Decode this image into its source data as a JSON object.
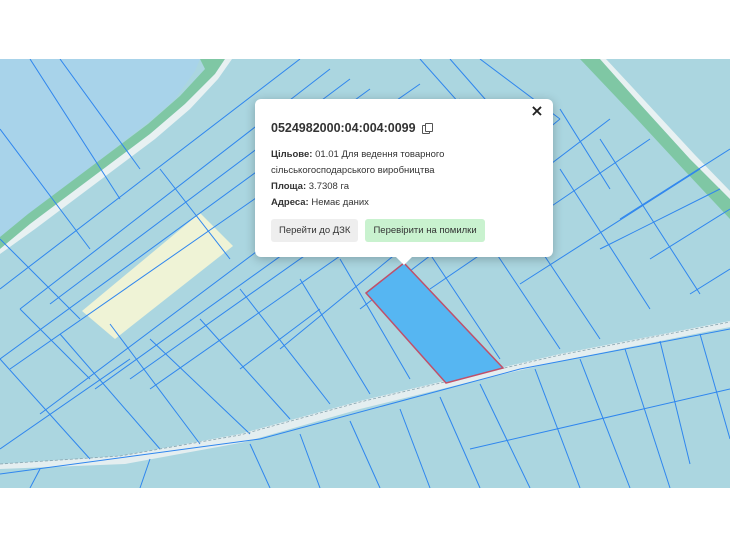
{
  "popup": {
    "cadastral_number": "0524982000:04:004:0099",
    "close_label": "×",
    "purpose_label": "Цільове:",
    "purpose_value": "01.01 Для ведення товарного сільськогосподарського виробництва",
    "area_label": "Площа:",
    "area_value": "3.7308 га",
    "address_label": "Адреса:",
    "address_value": "Немає даних",
    "btn_dzk": "Перейти до ДЗК",
    "btn_check": "Перевірити на помилки"
  },
  "colors": {
    "parcel_fill": "#abd6e0",
    "parcel_line": "#2f86ee",
    "selected_fill": "#56b6f2",
    "selected_outline": "#c0506a",
    "water": "#a8d3ea",
    "field_highlight": "#eff3d6",
    "road": "#e4eef0",
    "green_strip": "#7fc7a4",
    "primary_button_bg": "#c9f2cf",
    "secondary_button_bg": "#eeeeee"
  }
}
